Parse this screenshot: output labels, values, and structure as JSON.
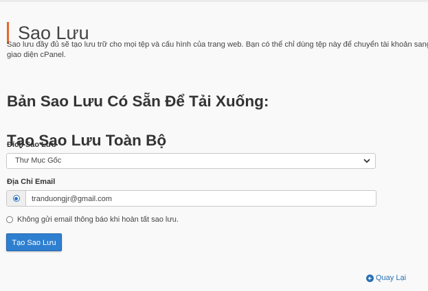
{
  "page": {
    "title": "Sao Lưu",
    "description_line1": "Sao lưu đầy đủ sẽ tạo lưu trữ cho mọi tệp và cấu hình của trang web. Bạn có thể chỉ dùng tệp này để chuyển tài khoản sang má",
    "description_line2": "giao diện cPanel."
  },
  "available_backups": {
    "heading": "Bản Sao Lưu Có Sẵn Để Tải Xuống:"
  },
  "full_backup": {
    "heading": "Tạo Sao Lưu Toàn Bộ",
    "destination_label": "Đích Sao Lưu",
    "destination_selected": "Thư Mục Gốc",
    "email_label": "Địa Chỉ Email",
    "email_value": "tranduongjr@gmail.com",
    "no_email_label": "Không gửi email thông báo khi hoàn tất sao lưu.",
    "submit_label": "Tạo Sao Lưu"
  },
  "footer": {
    "back_label": "Quay Lại"
  },
  "icons": {
    "select": "chevron-down-icon",
    "back": "arrow-circle-left-icon"
  },
  "colors": {
    "accent": "#e8652b",
    "primary": "#2e7fd0",
    "link": "#2a6fb5"
  }
}
